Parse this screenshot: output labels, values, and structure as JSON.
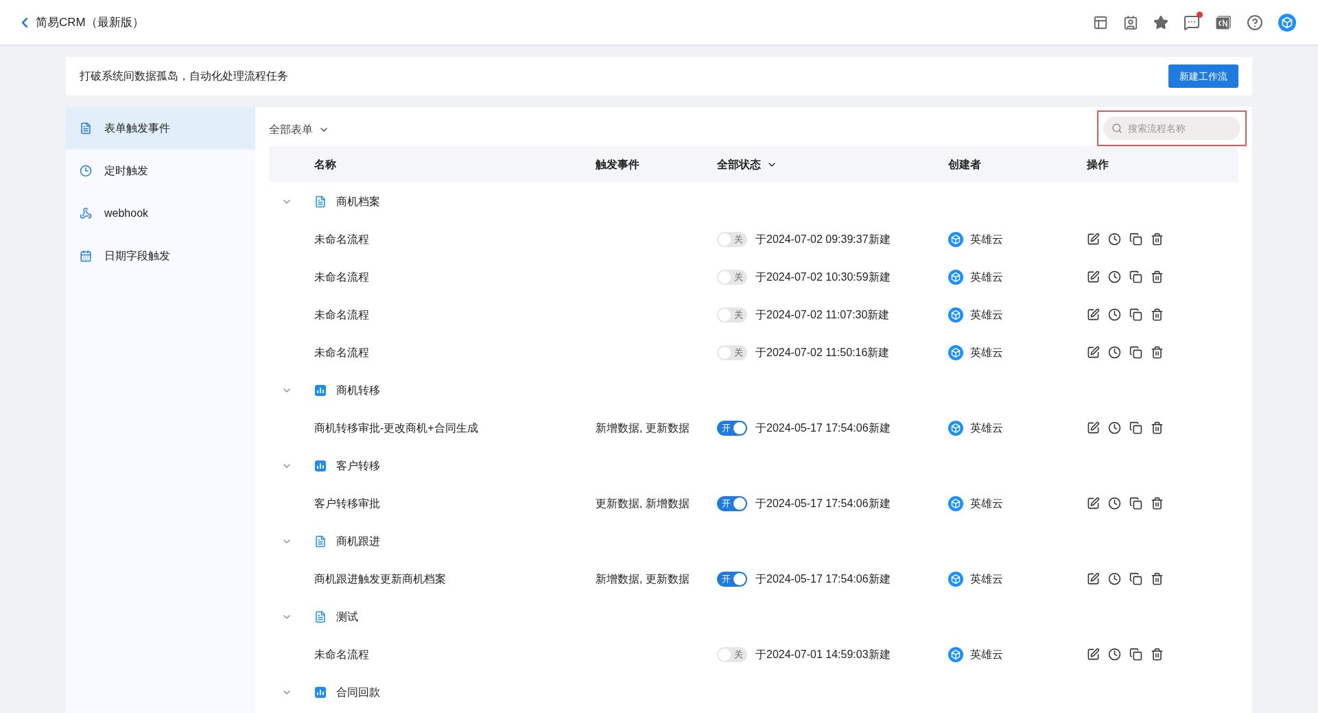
{
  "header": {
    "back_title": "简易CRM（最新版）",
    "notification_dot": true
  },
  "banner": {
    "text": "打破系统间数据孤岛，自动化处理流程任务",
    "button": "新建工作流"
  },
  "sidebar": {
    "items": [
      {
        "label": "表单触发事件",
        "kind": "form",
        "selected": true
      },
      {
        "label": "定时触发",
        "kind": "clock",
        "selected": false
      },
      {
        "label": "webhook",
        "kind": "webhook",
        "selected": false
      },
      {
        "label": "日期字段触发",
        "kind": "calendar",
        "selected": false
      }
    ]
  },
  "filter": {
    "label": "全部表单"
  },
  "search": {
    "placeholder": "搜索流程名称"
  },
  "table": {
    "columns": [
      "名称",
      "触发事件",
      "全部状态",
      "创建者",
      "操作"
    ],
    "groups": [
      {
        "name": "商机档案",
        "kind": "doc",
        "expanded": true,
        "children": [
          {
            "name": "未命名流程",
            "on": false,
            "toggle": "关",
            "created": "于2024-07-02 09:39:37新建",
            "creator": "英雄云"
          },
          {
            "name": "未命名流程",
            "on": false,
            "toggle": "关",
            "created": "于2024-07-02 10:30:59新建",
            "creator": "英雄云"
          },
          {
            "name": "未命名流程",
            "on": false,
            "toggle": "关",
            "created": "于2024-07-02 11:07:30新建",
            "creator": "英雄云"
          },
          {
            "name": "未命名流程",
            "on": false,
            "toggle": "关",
            "created": "于2024-07-02 11:50:16新建",
            "creator": "英雄云"
          }
        ]
      },
      {
        "name": "商机转移",
        "kind": "chart",
        "expanded": true,
        "children": [
          {
            "name": "商机转移审批-更改商机+合同生成",
            "trigger": "新增数据, 更新数据",
            "on": true,
            "toggle": "开",
            "created": "于2024-05-17 17:54:06新建",
            "creator": "英雄云"
          }
        ]
      },
      {
        "name": "客户转移",
        "kind": "chart",
        "expanded": true,
        "children": [
          {
            "name": "客户转移审批",
            "trigger": "更新数据, 新增数据",
            "on": true,
            "toggle": "开",
            "created": "于2024-05-17 17:54:06新建",
            "creator": "英雄云"
          }
        ]
      },
      {
        "name": "商机跟进",
        "kind": "doc",
        "expanded": true,
        "children": [
          {
            "name": "商机跟进触发更新商机档案",
            "trigger": "新增数据, 更新数据",
            "on": true,
            "toggle": "开",
            "created": "于2024-05-17 17:54:06新建",
            "creator": "英雄云"
          }
        ]
      },
      {
        "name": "测试",
        "kind": "doc",
        "expanded": true,
        "children": [
          {
            "name": "未命名流程",
            "on": false,
            "toggle": "关",
            "created": "于2024-07-01 14:59:03新建",
            "creator": "英雄云"
          }
        ]
      },
      {
        "name": "合同回款",
        "kind": "chart",
        "expanded": true
      }
    ]
  }
}
